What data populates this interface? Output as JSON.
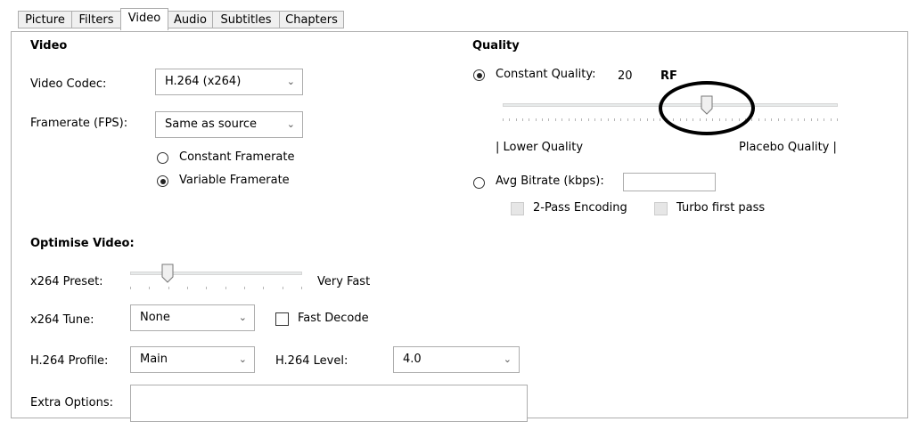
{
  "tabs": [
    {
      "label": "Picture"
    },
    {
      "label": "Filters"
    },
    {
      "label": "Video",
      "active": true
    },
    {
      "label": "Audio"
    },
    {
      "label": "Subtitles"
    },
    {
      "label": "Chapters"
    }
  ],
  "video": {
    "heading": "Video",
    "codec_label": "Video Codec:",
    "codec_value": "H.264 (x264)",
    "framerate_label": "Framerate (FPS):",
    "framerate_value": "Same as source",
    "constant_framerate": "Constant Framerate",
    "variable_framerate": "Variable Framerate",
    "framerate_mode": "variable"
  },
  "quality": {
    "heading": "Quality",
    "constant_quality_label": "Constant Quality:",
    "rf_value": "20",
    "rf_unit": "RF",
    "lower_label": "| Lower Quality",
    "placebo_label": "Placebo Quality |",
    "avg_bitrate_label": "Avg Bitrate (kbps):",
    "avg_bitrate_value": "",
    "two_pass_label": "2-Pass Encoding",
    "turbo_label": "Turbo first pass",
    "mode": "constant",
    "slider_fraction": 0.61
  },
  "optimise": {
    "heading": "Optimise Video:",
    "preset_label": "x264 Preset:",
    "preset_value": "Very Fast",
    "preset_slider_fraction": 0.22,
    "tune_label": "x264 Tune:",
    "tune_value": "None",
    "fast_decode_label": "Fast Decode",
    "profile_label": "H.264 Profile:",
    "profile_value": "Main",
    "level_label": "H.264 Level:",
    "level_value": "4.0",
    "extra_label": "Extra Options:",
    "extra_value": ""
  },
  "icons": {
    "dropdown": "chevron-down-icon"
  }
}
